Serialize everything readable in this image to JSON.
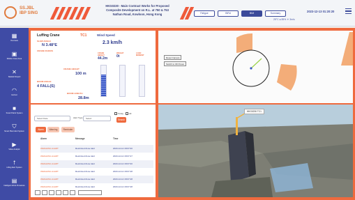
{
  "header": {
    "logo_text": "SS.JBL\nIBP SING",
    "title_lines": [
      "HKG0230 - Main Contract Works for Proposed",
      "Composite Development on R.L. at 750 & 753",
      "Nathan Road, Kowloon, Hong Kong"
    ],
    "nav_buttons": [
      "Fatigue",
      "BIRd",
      "BIM",
      "Summary"
    ],
    "active_nav": 2,
    "weather_text": "25°C  ● 85%  ☀ 3m/s",
    "datetime": "2023-12-13 01:20:20"
  },
  "sidebar": {
    "items": [
      {
        "label": "Overview",
        "icon": "dashboard-icon"
      },
      {
        "label": "Mobile Crane Area",
        "icon": "crane-area-icon"
      },
      {
        "label": "Statistic Report",
        "icon": "tools-icon"
      },
      {
        "label": "Helmet",
        "icon": "helmet-icon"
      },
      {
        "label": "Smart Patrol System",
        "icon": "patrol-icon"
      },
      {
        "label": "Smart Plant Alert System",
        "icon": "shield-icon"
      },
      {
        "label": "Video Analytic",
        "icon": "camera-icon"
      },
      {
        "label": "Lifting Alert System",
        "icon": "lift-icon"
      },
      {
        "label": "Intelligent Work Procedure",
        "icon": "chat-icon"
      }
    ]
  },
  "crane": {
    "heading": "Luffing Crane",
    "crane_id": "TC1",
    "slew_angle_label": "SLEW ANGLE",
    "slew_angle": "N 3.48°E",
    "crane_radius_label": "CRANE RADIUS",
    "crane_height_label": "CRANE HEIGHT",
    "crane_height": "100 m",
    "boom_angle_label": "BOOM ANGLE",
    "boom_angle": "4 FALL(S)",
    "boom_length_label": "BOOM LENGTH",
    "boom_length": "28.8m"
  },
  "wind": {
    "title": "Wind Speed",
    "value": "2.3 km/h",
    "gauges": [
      {
        "label": "CRANE HEIGHT",
        "value": "44.2m",
        "level": 0.7
      },
      {
        "label": "WEIGHT",
        "value": "0t",
        "level": 0
      },
      {
        "label": "LOAD MOMENT",
        "value": "",
        "level": 0
      }
    ]
  },
  "alarms": {
    "select_placeholder": "Select Date",
    "alert_type_label": "Alert Type",
    "alert_type_placeholder": "Select",
    "today_label": "Today",
    "all_label": "All",
    "search_label": "Search",
    "tabs": [
      "Alarm",
      "Warning",
      "Reminder"
    ],
    "columns": [
      "Alarm",
      "Message",
      "Time"
    ],
    "rows": [
      {
        "alarm": "WEIGHING ALERT",
        "message": "Restricted Zone Alert",
        "time": "2023-12-12 18:07:00"
      },
      {
        "alarm": "WEIGHING ALERT",
        "message": "Restricted Zone Alert",
        "time": "2023-12-12 18:07:27"
      },
      {
        "alarm": "WEIGHING ALERT",
        "message": "Restricted Zone Alert",
        "time": "2023-12-12 18:07:00"
      },
      {
        "alarm": "WEIGHING ALERT",
        "message": "Restricted Zone Alert",
        "time": "2023-12-12 18:07:28"
      },
      {
        "alarm": "WEIGHING ALERT",
        "message": "Restricted Zone Alert",
        "time": "2023-12-12 18:07:28"
      },
      {
        "alarm": "WEIGHING ALERT",
        "message": "Restricted Zone Alert",
        "time": "2023-12-12 18:07:28"
      }
    ]
  },
  "topview": {
    "reset_camera": "Reset Camera",
    "switch_view": "Switch to 3D Poses"
  },
  "view3d": {
    "tag": "HKG0230 TC1"
  },
  "colors": {
    "accent": "#ef6a3e",
    "brand": "#3f4ba5",
    "value": "#2d3a8c"
  }
}
